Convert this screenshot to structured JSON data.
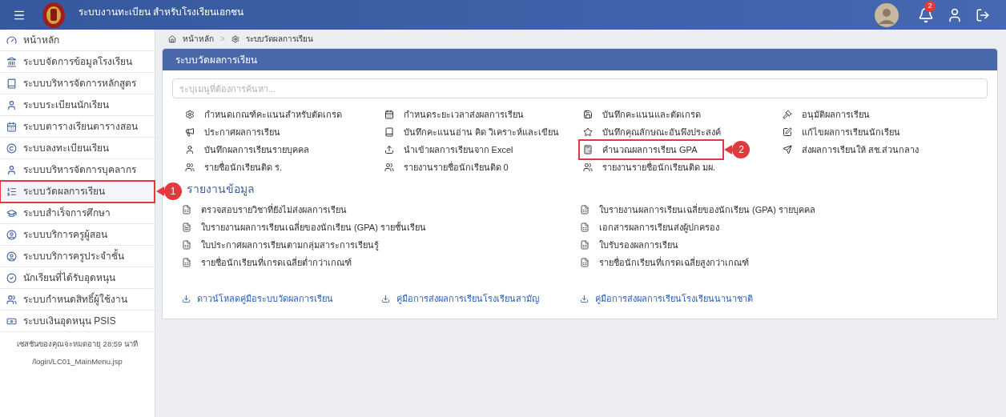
{
  "header": {
    "title": "ระบบงานทะเบียน สำหรับโรงเรียนเอกชน",
    "notification_count": "2"
  },
  "sidebar": {
    "items": [
      {
        "label": "หน้าหลัก",
        "selected": false
      },
      {
        "label": "ระบบจัดการข้อมูลโรงเรียน",
        "selected": false
      },
      {
        "label": "ระบบบริหารจัดการหลักสูตร",
        "selected": false
      },
      {
        "label": "ระบบระเบียนนักเรียน",
        "selected": false
      },
      {
        "label": "ระบบตารางเรียนตารางสอน",
        "selected": false
      },
      {
        "label": "ระบบลงทะเบียนเรียน",
        "selected": false
      },
      {
        "label": "ระบบบริหารจัดการบุคลากร",
        "selected": false
      },
      {
        "label": "ระบบวัดผลการเรียน",
        "selected": true,
        "callout": "1"
      },
      {
        "label": "ระบบสำเร็จการศึกษา",
        "selected": false
      },
      {
        "label": "ระบบบริการครูผู้สอน",
        "selected": false
      },
      {
        "label": "ระบบบริการครูประจำชั้น",
        "selected": false
      },
      {
        "label": "นักเรียนที่ได้รับอุดหนุน",
        "selected": false
      },
      {
        "label": "ระบบกำหนดสิทธิ์ผู้ใช้งาน",
        "selected": false
      },
      {
        "label": "ระบบเงินอุดหนุน PSIS",
        "selected": false
      }
    ],
    "session_note": "เซสชันของคุณจะหมดอายุ 28:59 นาที",
    "path": "/login/LC01_MainMenu.jsp"
  },
  "breadcrumb": [
    "หน้าหลัก",
    "ระบบวัดผลการเรียน"
  ],
  "breadcrumb_separator": ">",
  "panel": {
    "title": "ระบบวัดผลการเรียน",
    "search": {
      "placeholder": "ระบุเมนูที่ต้องการค้นหา..."
    },
    "menu_items": [
      {
        "label": "กำหนดเกณฑ์คะแนนสำหรับตัดเกรด"
      },
      {
        "label": "กำหนดระยะเวลาส่งผลการเรียน"
      },
      {
        "label": "บันทึกคะแนนและตัดเกรด"
      },
      {
        "label": "อนุมัติผลการเรียน"
      },
      {
        "label": "ประกาศผลการเรียน"
      },
      {
        "label": "บันทึกคะแนนอ่าน คิด วิเคราะห์และเขียน"
      },
      {
        "label": "บันทึกคุณลักษณะอันพึงประสงค์"
      },
      {
        "label": "แก้ไขผลการเรียนนักเรียน"
      },
      {
        "label": "บันทึกผลการเรียนรายบุคคล"
      },
      {
        "label": "นำเข้าผลการเรียนจาก Excel"
      },
      {
        "label": "คำนวณผลการเรียน GPA",
        "callout": "2"
      },
      {
        "label": "ส่งผลการเรียนให้ สช.ส่วนกลาง"
      },
      {
        "label": "รายชื่อนักเรียนติด ร."
      },
      {
        "label": "รายงานรายชื่อนักเรียนติด 0"
      },
      {
        "label": "รายงานรายชื่อนักเรียนติด มผ."
      }
    ],
    "reports_heading": "รายงานข้อมูล",
    "reports": [
      {
        "label": "ตรวจสอบรายวิชาที่ยังไม่ส่งผลการเรียน",
        "kind": "excel"
      },
      {
        "label": "ใบรายงานผลการเรียนเฉลี่ยของนักเรียน (GPA) รายบุคคล",
        "kind": "excel"
      },
      {
        "label": "ใบรายงานผลการเรียนเฉลี่ยของนักเรียน (GPA) รายชั้นเรียน",
        "kind": "pdf"
      },
      {
        "label": "เอกสารผลการเรียนส่งผู้ปกครอง",
        "kind": "excel"
      },
      {
        "label": "ใบประกาศผลการเรียนตามกลุ่มสาระการเรียนรู้",
        "kind": "excel"
      },
      {
        "label": "ใบรับรองผลการเรียน",
        "kind": "excel"
      },
      {
        "label": "รายชื่อนักเรียนที่เกรดเฉลี่ยต่ำกว่าเกณฑ์",
        "kind": "excel"
      },
      {
        "label": "รายชื่อนักเรียนที่เกรดเฉลี่ยสูงกว่าเกณฑ์",
        "kind": "excel"
      }
    ],
    "downloads": [
      "ดาวน์โหลดคู่มือระบบวัดผลการเรียน",
      "คู่มือการส่งผลการเรียนโรงเรียนสามัญ",
      "คู่มือการส่งผลการเรียนโรงเรียนนานาชาติ"
    ]
  }
}
